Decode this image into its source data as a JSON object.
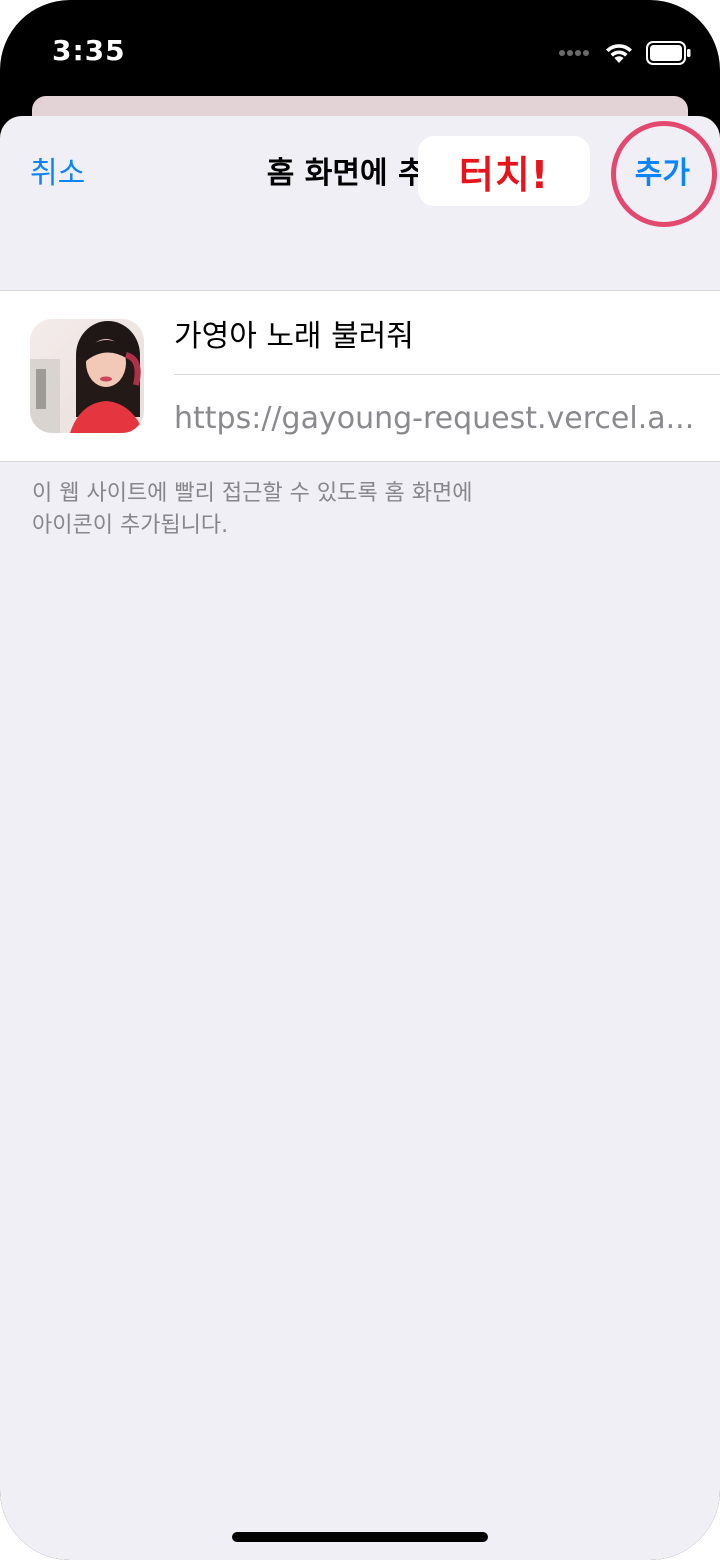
{
  "status_bar": {
    "time": "3:35",
    "icons": [
      "cellular-signal-icon",
      "wifi-icon",
      "battery-icon"
    ]
  },
  "nav": {
    "cancel_label": "취소",
    "title": "홈 화면에 추가",
    "add_label": "추가"
  },
  "annotation": {
    "callout_text": "터치!",
    "callout_color": "#e8141c",
    "ring_color": "#e4486e"
  },
  "bookmark": {
    "name": "가영아 노래 불러줘",
    "url": "https://gayoung-request.vercel.a..."
  },
  "footer": {
    "line1": "이 웹 사이트에 빨리 접근할 수 있도록 홈 화면에",
    "line2": "아이콘이 추가됩니다."
  },
  "colors": {
    "accent": "#0a84ff",
    "sheet_background": "#f0eff5"
  }
}
